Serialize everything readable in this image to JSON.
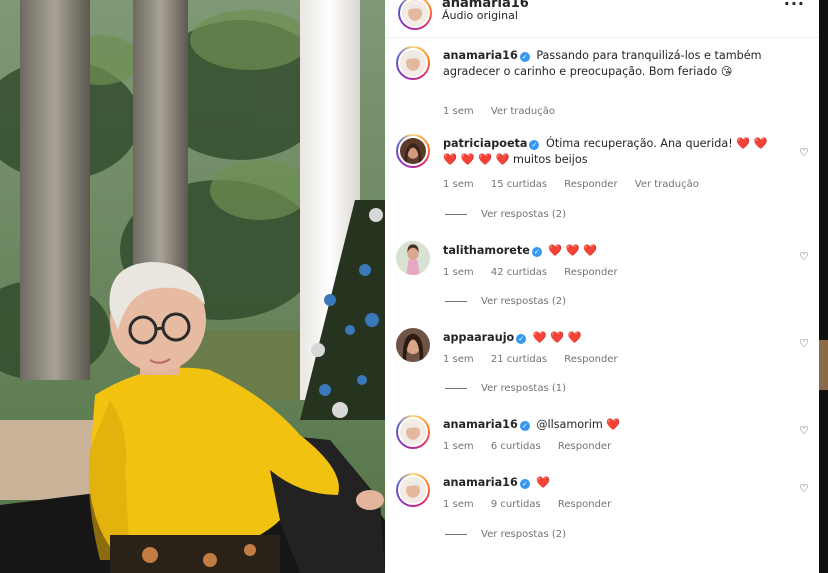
{
  "post": {
    "username": "anamaria16",
    "audio_label": "Áudio original",
    "more_label": "···"
  },
  "comments": [
    {
      "username": "anamaria16",
      "text": "Passando para tranquilizá-los e também agradecer o carinho e preocupação. Bom feriado 😘",
      "time": "1 sem",
      "translate": "Ver tradução"
    },
    {
      "username": "patriciapoeta",
      "text": "Ótima recuperação. Ana querida! ❤️ ❤️ ❤️ ❤️ ❤️ ❤️ muitos beijos",
      "time": "1 sem",
      "likes": "15 curtidas",
      "reply": "Responder",
      "translate": "Ver tradução",
      "view_replies": "Ver respostas (2)"
    },
    {
      "username": "talithamorete",
      "text": "❤️ ❤️ ❤️",
      "time": "1 sem",
      "likes": "42 curtidas",
      "reply": "Responder",
      "view_replies": "Ver respostas (2)"
    },
    {
      "username": "appaaraujo",
      "text": "❤️ ❤️ ❤️",
      "time": "1 sem",
      "likes": "21 curtidas",
      "reply": "Responder",
      "view_replies": "Ver respostas (1)"
    },
    {
      "username": "anamaria16",
      "text": "@llsamorim ❤️",
      "time": "1 sem",
      "likes": "6 curtidas",
      "reply": "Responder"
    },
    {
      "username": "anamaria16",
      "text": "❤️",
      "time": "1 sem",
      "likes": "9 curtidas",
      "reply": "Responder",
      "view_replies": "Ver respostas (2)"
    }
  ],
  "icons": {
    "like": "heart-outline-icon",
    "verified": "verified-badge-icon",
    "more": "more-options-icon"
  },
  "colors": {
    "verified": "#3897f0",
    "heart": "#e8112d",
    "muted": "#737373",
    "sweater": "#f2c211"
  }
}
